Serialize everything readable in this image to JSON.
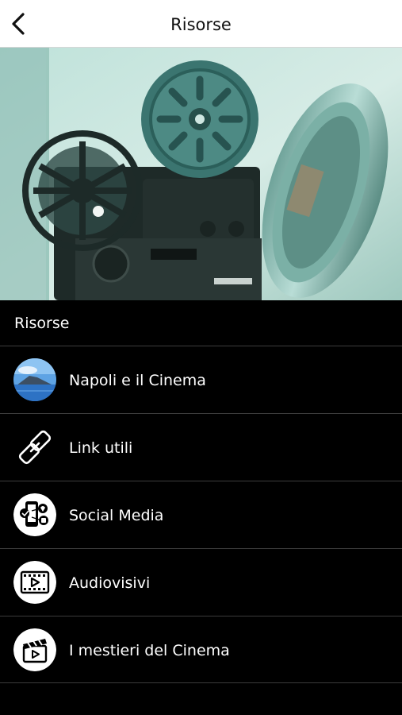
{
  "header": {
    "title": "Risorse",
    "back_icon": "chevron-left-icon"
  },
  "hero": {
    "image": "film-projector-photo"
  },
  "section": {
    "title": "Risorse"
  },
  "items": [
    {
      "label": "Napoli e il Cinema",
      "icon": "vesuvius-photo-icon"
    },
    {
      "label": "Link utili",
      "icon": "chain-link-icon"
    },
    {
      "label": "Social Media",
      "icon": "social-media-phone-icon"
    },
    {
      "label": "Audiovisivi",
      "icon": "film-strip-play-icon"
    },
    {
      "label": "I mestieri del Cinema",
      "icon": "clapperboard-icon"
    }
  ],
  "colors": {
    "background": "#000000",
    "header_bg": "#ffffff",
    "text": "#ffffff",
    "divider": "#3c3c3c"
  }
}
